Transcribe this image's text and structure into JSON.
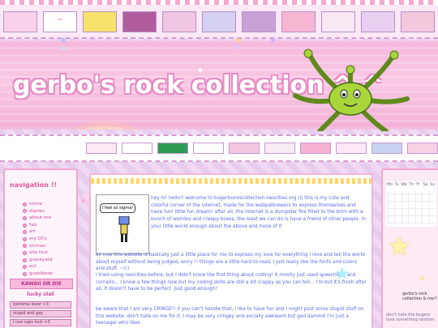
{
  "site": {
    "title": "gerbo's rock collection ^-^"
  },
  "sidebar": {
    "heading": "navigation !!",
    "items": [
      {
        "label": "home"
      },
      {
        "label": "diaries"
      },
      {
        "label": "about me"
      },
      {
        "label": "faq"
      },
      {
        "label": "art"
      },
      {
        "label": "my OCs"
      },
      {
        "label": "shrines"
      },
      {
        "label": "site tour"
      },
      {
        "label": "graveyard"
      },
      {
        "label": "ect"
      },
      {
        "label": "guestbook"
      }
    ],
    "kawaii_banner": "KAWAII OR DIE",
    "lucky_stat": "lucky stat",
    "selects": [
      {
        "value": "extreme lover <3"
      },
      {
        "value": "stupid and gay"
      },
      {
        "value": "i use caps lock <3"
      }
    ]
  },
  "main": {
    "image_caption": "I feel so sigma!",
    "intro": "hey hi! hello!! welcome to bugerbunoscollection.neocities.org (i) this is my cute and colorful corner of the internet, made for the webpalbrewers to express themselves and have fun! little fun dream! after all, the internet is a dumpster fire filled to the brim with a bunch of weirdos and creepy boxes, the least we can do is have a friend of other people. in your little world enough about the above and more of it",
    "intro_cont": "all now this website is basically just a little place for me to express my love for everything I love and tell the world about myself without being judged, sorry !! things are a little hard to read, I just really like the fonts and colors and stuff. ~(!)",
    "para2": "I tried using neocities before, but I didn't know the first thing about coding! it mostly just used speechless and cornelio... I know a few things now but my coding skills are still a bit crappy as you can tell... I'm but it's fresh after all, it doesn't have to be perfect. Just good enough!",
    "para3": "be aware that I am very CRINGE!! if you can't handle that, I like to have fun and I might post some stupid stuff on this website. don't hate on me for it. I may be very cringey and socially awkward but god dammit I'm just a teenager who likes"
  },
  "right_sidebar": {
    "calendar_header": [
      "Mo",
      "Tu",
      "We",
      "Th",
      "Fr",
      "Sa",
      "Su"
    ],
    "note": "gerbo's rock collection & me!!",
    "note2": "don't hate the bugers love something random"
  },
  "colors": {
    "accent_pink": "#e0559f",
    "text_blue": "#5b6ae0",
    "title_outline": "#e88bc5",
    "border_pink": "#f4a7cf"
  }
}
